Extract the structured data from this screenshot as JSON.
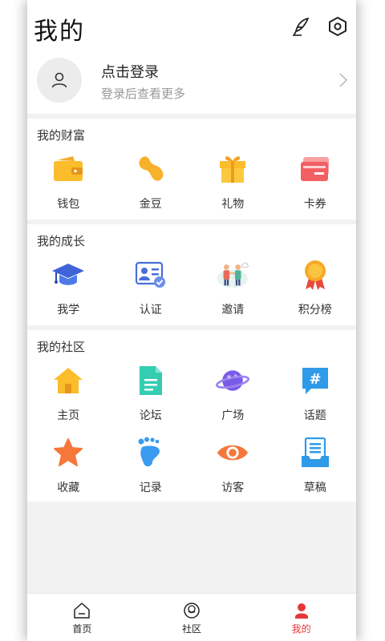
{
  "header": {
    "title": "我的"
  },
  "profile": {
    "login": "点击登录",
    "sub": "登录后查看更多"
  },
  "sections": [
    {
      "title": "我的财富",
      "items": [
        {
          "label": "钱包",
          "icon": "wallet-icon"
        },
        {
          "label": "金豆",
          "icon": "bean-icon"
        },
        {
          "label": "礼物",
          "icon": "gift-icon"
        },
        {
          "label": "卡券",
          "icon": "coupon-icon"
        }
      ]
    },
    {
      "title": "我的成长",
      "items": [
        {
          "label": "我学",
          "icon": "graduation-cap-icon"
        },
        {
          "label": "认证",
          "icon": "certification-icon"
        },
        {
          "label": "邀请",
          "icon": "invite-people-icon"
        },
        {
          "label": "积分榜",
          "icon": "medal-icon"
        }
      ]
    },
    {
      "title": "我的社区",
      "items": [
        {
          "label": "主页",
          "icon": "home-icon"
        },
        {
          "label": "论坛",
          "icon": "forum-document-icon"
        },
        {
          "label": "广场",
          "icon": "planet-icon"
        },
        {
          "label": "话题",
          "icon": "hashtag-icon"
        },
        {
          "label": "收藏",
          "icon": "star-icon"
        },
        {
          "label": "记录",
          "icon": "footprint-icon"
        },
        {
          "label": "访客",
          "icon": "eye-icon"
        },
        {
          "label": "草稿",
          "icon": "draft-icon"
        }
      ]
    }
  ],
  "tabs": [
    {
      "label": "首页",
      "icon": "home-outline-icon",
      "active": false
    },
    {
      "label": "社区",
      "icon": "community-icon",
      "active": false
    },
    {
      "label": "我的",
      "icon": "user-icon",
      "active": true
    }
  ],
  "colors": {
    "accent": "#e5383b",
    "background": "#f2f2f2"
  }
}
